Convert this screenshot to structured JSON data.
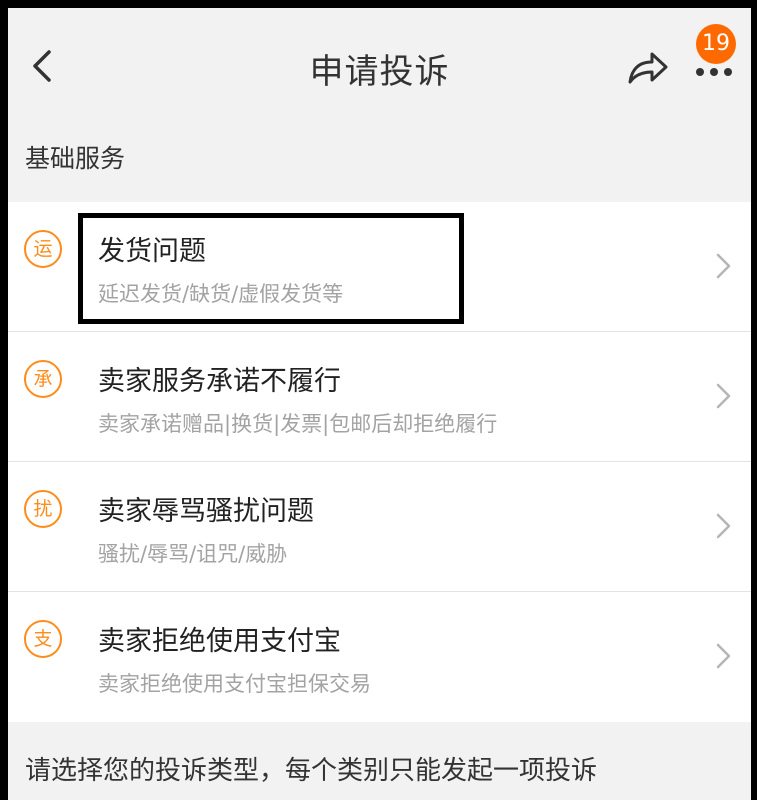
{
  "header": {
    "title": "申请投诉",
    "badge_count": "19",
    "back_icon": "chevron-left-icon",
    "share_icon": "share-arrow-icon",
    "more_icon": "more-dots-icon"
  },
  "section": {
    "title": "基础服务"
  },
  "complaints": [
    {
      "icon_char": "运",
      "title": "发货问题",
      "subtitle": "延迟发货/缺货/虚假发货等"
    },
    {
      "icon_char": "承",
      "title": "卖家服务承诺不履行",
      "subtitle": "卖家承诺赠品|换货|发票|包邮后却拒绝履行"
    },
    {
      "icon_char": "扰",
      "title": "卖家辱骂骚扰问题",
      "subtitle": "骚扰/辱骂/诅咒/威胁"
    },
    {
      "icon_char": "支",
      "title": "卖家拒绝使用支付宝",
      "subtitle": "卖家拒绝使用支付宝担保交易"
    }
  ],
  "footer": {
    "note": "请选择您的投诉类型，每个类别只能发起一项投诉"
  },
  "colors": {
    "accent": "#ff8c1a",
    "badge": "#ff6a00",
    "background": "#f2f2f2"
  }
}
